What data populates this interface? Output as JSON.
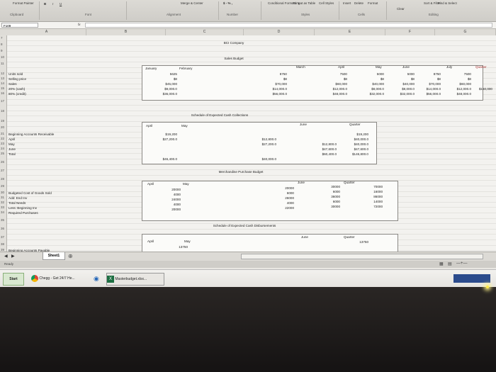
{
  "ribbon": {
    "format_painter": "Format Painter",
    "clipboard": "Clipboard",
    "font": "Font",
    "alignment": "Alignment",
    "merge_center": "Merge & Center",
    "number_symbols": "$ - % ,",
    "number": "Number",
    "conditional_formatting": "Conditional Formatting",
    "format_as_table": "Format as Table",
    "cell_styles": "Cell Styles",
    "styles": "Styles",
    "insert": "Insert",
    "delete": "Delete",
    "format": "Format",
    "cells": "Cells",
    "clear": "Clear",
    "sort_filter": "Sort & Filter",
    "find_select": "Find & Select",
    "editing": "Editing"
  },
  "formula_bar": {
    "name_box": "F109",
    "fx": "fx"
  },
  "columns": [
    "A",
    "B",
    "C",
    "D",
    "E",
    "F",
    "G"
  ],
  "rows": [
    "7",
    "8",
    "9",
    "10",
    "11",
    "12",
    "13",
    "14",
    "15",
    "16",
    "17",
    "18",
    "19",
    "20",
    "21",
    "22",
    "23",
    "24",
    "25",
    "26",
    "27",
    "28",
    "29",
    "30",
    "31",
    "32",
    "33",
    "34",
    "35",
    "36",
    "37",
    "38",
    "39"
  ],
  "labels": {
    "units_sold": "Units sold",
    "selling_price": "Selling price",
    "sales": "Sales",
    "cash20": "20% (cash)",
    "credit80": "80% (credit)",
    "beg_ar": "Beginning Accounts Receivable",
    "april": "April",
    "may": "May",
    "june": "June",
    "total": "Total",
    "budgeted_cogs": "Budgeted Cost of Goods Sold",
    "add_end_inv": "Add: End Inv",
    "total_needs": "Total Needs",
    "less_beg_inv": "Less: Beginning Inv",
    "required_purchases": "Required Purchases",
    "beg_ap": "Beginning Accounts Payable"
  },
  "titles": {
    "company": "BCI Company",
    "sales_budget": "Sales Budget",
    "cash_collections": "Schedule of Expected Cash Collections",
    "merch_budget": "Merchandise Purchase Budget",
    "cash_disbursements": "Schedule of Expected Cash Disbursements"
  },
  "sales_budget": {
    "months": [
      "January",
      "February",
      "March",
      "April",
      "May",
      "June",
      "July",
      "Quarter"
    ],
    "units": [
      "5625",
      "",
      "8750",
      "7500",
      "5000",
      "5000",
      "8750",
      "7500"
    ],
    "price": [
      "$8",
      "",
      "$8",
      "$8",
      "$8",
      "$8",
      "$8",
      "$8"
    ],
    "sales": [
      "$45,000",
      "",
      "$70,000",
      "$60,000",
      "$40,000",
      "$40,000",
      "$70,000",
      "$60,000"
    ],
    "cash": [
      "$9,000.0",
      "",
      "$14,000.0",
      "$12,000.0",
      "$8,000.0",
      "$8,000.0",
      "$14,000.0",
      "$12,000.0"
    ],
    "credit": [
      "$36,000.0",
      "",
      "$56,000.0",
      "$48,000.0",
      "$32,000.0",
      "$32,000.0",
      "$56,000.0",
      "$48,000.0"
    ],
    "quarter_total": "$150,000"
  },
  "cash_collections": {
    "headers": [
      "April",
      "May",
      "June",
      "Quarter"
    ],
    "beg_ar": [
      "$19,200",
      "",
      "",
      "$19,200"
    ],
    "april": [
      "$27,200.0",
      "$12,800.0",
      "",
      "$40,000.0"
    ],
    "may": [
      "",
      "$27,200.0",
      "$12,800.0",
      "$40,000.0"
    ],
    "june": [
      "",
      "",
      "$47,600.0",
      "$47,600.0"
    ],
    "total": [
      "$46,400.0",
      "$40,000.0",
      "$60,400.0",
      "$146,800.0"
    ]
  },
  "merch": {
    "headers": [
      "April",
      "May",
      "June",
      "Quarter"
    ],
    "cogs": [
      "20000",
      "20000",
      "30000",
      "70000"
    ],
    "end_inv": [
      "4000",
      "6000",
      "6000",
      "16000"
    ],
    "total_needs": [
      "24000",
      "26000",
      "36000",
      "86000"
    ],
    "beg_inv": [
      "4000",
      "4000",
      "6000",
      "14000"
    ],
    "required": [
      "20000",
      "22000",
      "30000",
      "72000"
    ]
  },
  "disb": {
    "headers": [
      "April",
      "May",
      "June",
      "Quarter"
    ],
    "beg_ap": "13750",
    "quarter_beg_ap": "13750"
  },
  "sheet_tab": "Sheet1",
  "status": "Ready",
  "taskbar": {
    "start": "Start",
    "chrome": "Chegg - Get 24/7 He...",
    "excel": "Masterbudget.xlsx..."
  }
}
